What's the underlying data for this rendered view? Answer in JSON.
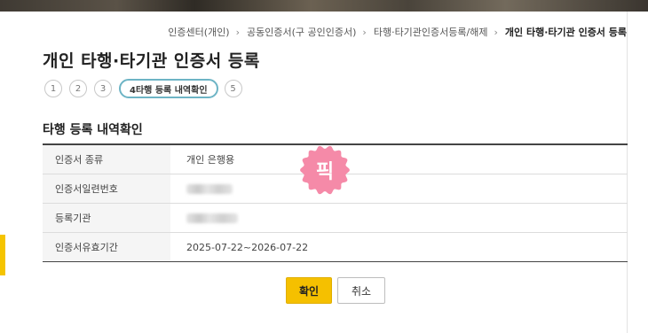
{
  "breadcrumb": [
    {
      "label": "인증센터(개인)"
    },
    {
      "label": "공동인증서(구 공인인증서)"
    },
    {
      "label": "타행·타기관인증서등록/해제"
    },
    {
      "label": "개인 타행·타기관 인증서 등록"
    }
  ],
  "breadcrumb_separator": "›",
  "page_title": "개인 타행·타기관 인증서 등록",
  "steps": [
    {
      "label": "1"
    },
    {
      "label": "2"
    },
    {
      "label": "3"
    },
    {
      "label": "4타행 등록 내역확인",
      "active": true
    },
    {
      "label": "5"
    }
  ],
  "section_title": "타행 등록 내역확인",
  "table": {
    "rows": [
      {
        "label": "인증서 종류",
        "value": "개인 은행용"
      },
      {
        "label": "인증서일련번호",
        "value": ""
      },
      {
        "label": "등록기관",
        "value": ""
      },
      {
        "label": "인증서유효기간",
        "value": "2025-07-22~2026-07-22"
      }
    ]
  },
  "stamp": {
    "text": "픽",
    "color": "#f58aa8"
  },
  "buttons": {
    "confirm": "확인",
    "cancel": "취소"
  },
  "colors": {
    "accent_yellow": "#f5c000",
    "step_active_border": "#6db4c5"
  }
}
